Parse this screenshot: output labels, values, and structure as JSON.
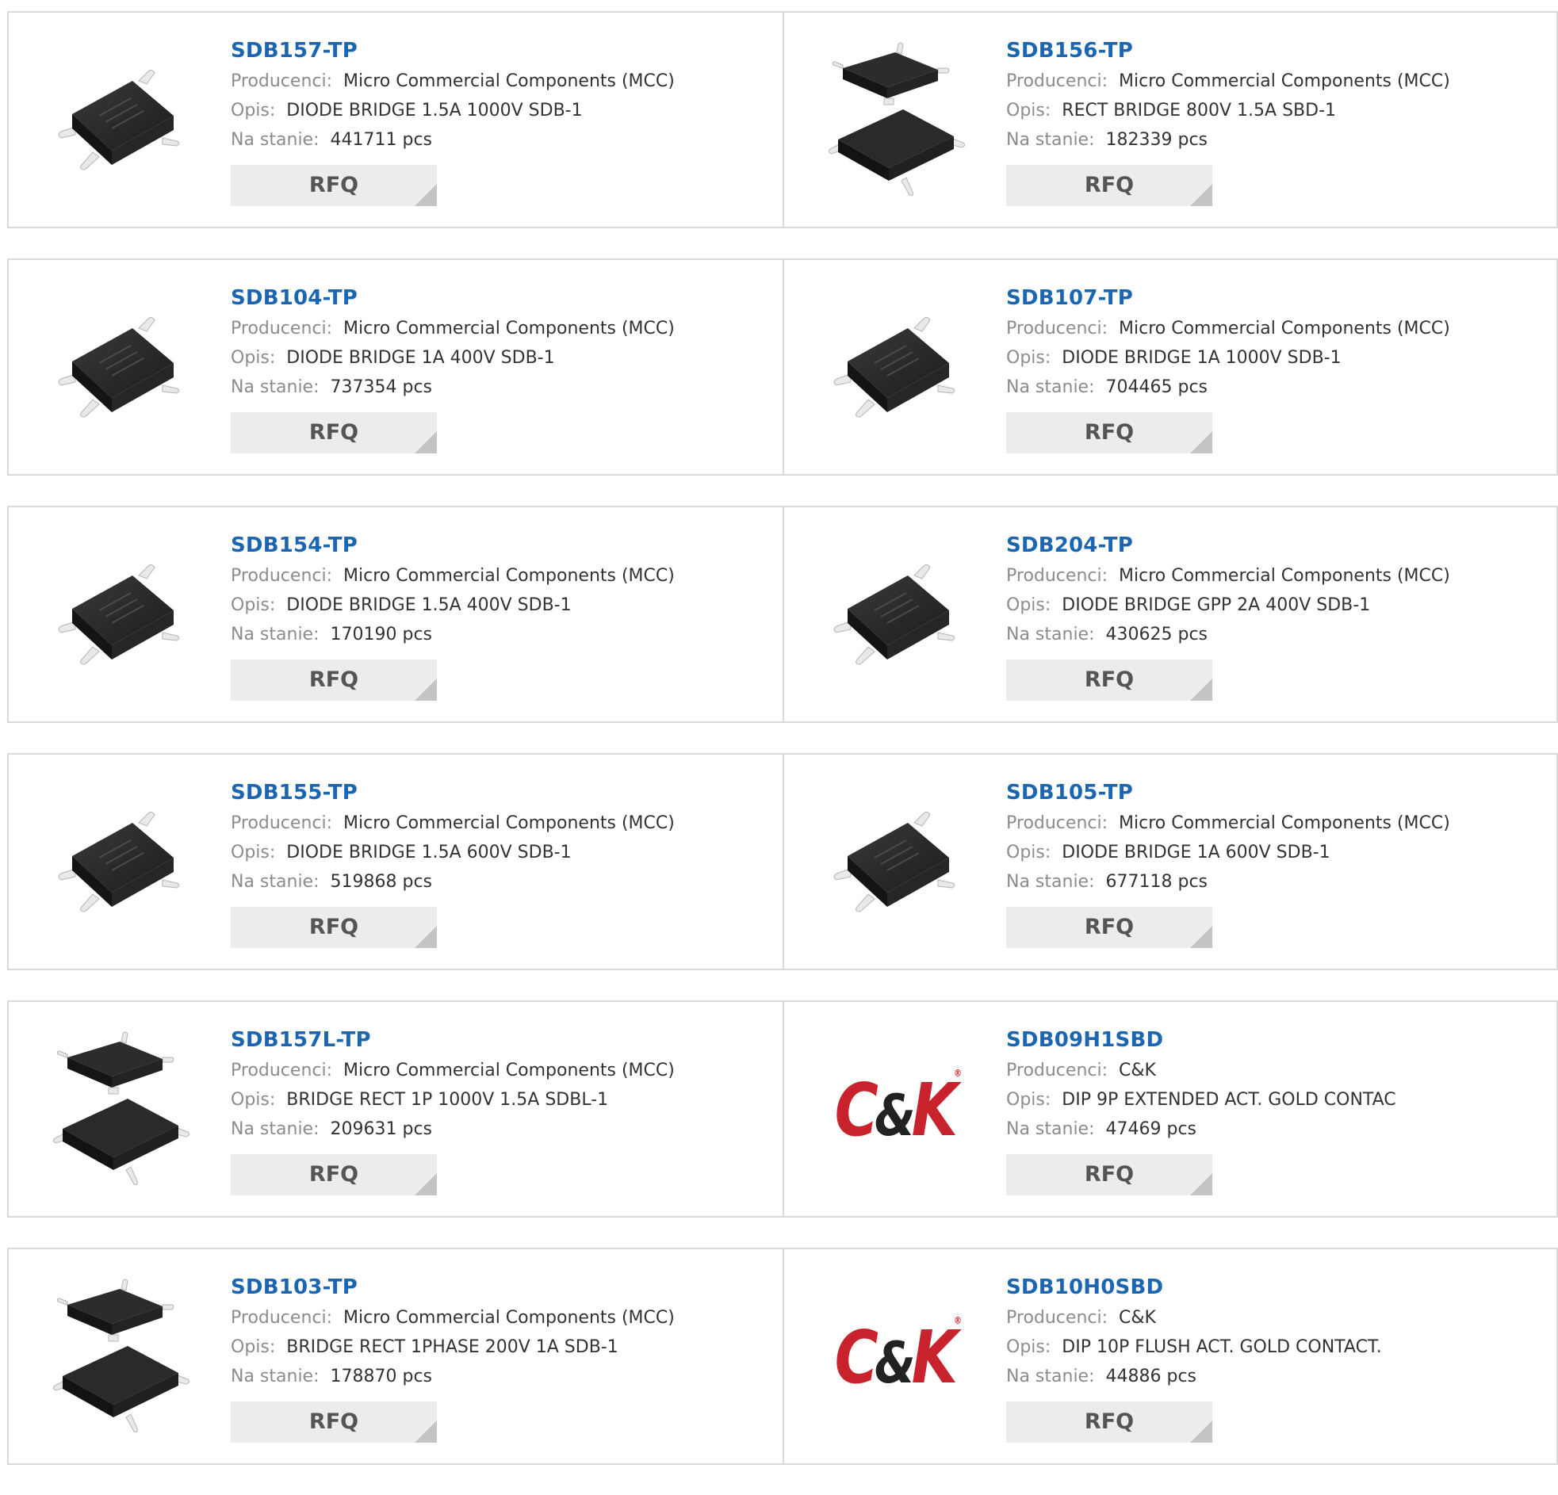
{
  "labels": {
    "manufacturer": "Producenci:",
    "description": "Opis:",
    "stock": "Na stanie:"
  },
  "rfq_label": "RFQ",
  "products": [
    {
      "part": "SDB157-TP",
      "manufacturer": "Micro Commercial Components (MCC)",
      "description": "DIODE BRIDGE 1.5A 1000V SDB-1",
      "stock": "441711 pcs",
      "image": "chip-single"
    },
    {
      "part": "SDB156-TP",
      "manufacturer": "Micro Commercial Components (MCC)",
      "description": "RECT BRIDGE 800V 1.5A SBD-1",
      "stock": "182339 pcs",
      "image": "chip-pair"
    },
    {
      "part": "SDB104-TP",
      "manufacturer": "Micro Commercial Components (MCC)",
      "description": "DIODE BRIDGE 1A 400V SDB-1",
      "stock": "737354 pcs",
      "image": "chip-single"
    },
    {
      "part": "SDB107-TP",
      "manufacturer": "Micro Commercial Components (MCC)",
      "description": "DIODE BRIDGE 1A 1000V SDB-1",
      "stock": "704465 pcs",
      "image": "chip-single"
    },
    {
      "part": "SDB154-TP",
      "manufacturer": "Micro Commercial Components (MCC)",
      "description": "DIODE BRIDGE 1.5A 400V SDB-1",
      "stock": "170190 pcs",
      "image": "chip-single"
    },
    {
      "part": "SDB204-TP",
      "manufacturer": "Micro Commercial Components (MCC)",
      "description": "DIODE BRIDGE GPP 2A 400V SDB-1",
      "stock": "430625 pcs",
      "image": "chip-single"
    },
    {
      "part": "SDB155-TP",
      "manufacturer": "Micro Commercial Components (MCC)",
      "description": "DIODE BRIDGE 1.5A 600V SDB-1",
      "stock": "519868 pcs",
      "image": "chip-single"
    },
    {
      "part": "SDB105-TP",
      "manufacturer": "Micro Commercial Components (MCC)",
      "description": "DIODE BRIDGE 1A 600V SDB-1",
      "stock": "677118 pcs",
      "image": "chip-single"
    },
    {
      "part": "SDB157L-TP",
      "manufacturer": "Micro Commercial Components (MCC)",
      "description": "BRIDGE RECT 1P 1000V 1.5A SDBL-1",
      "stock": "209631 pcs",
      "image": "chip-pair"
    },
    {
      "part": "SDB09H1SBD",
      "manufacturer": "C&K",
      "description": "DIP 9P EXTENDED ACT. GOLD CONTAC",
      "stock": "47469 pcs",
      "image": "ck-logo"
    },
    {
      "part": "SDB103-TP",
      "manufacturer": "Micro Commercial Components (MCC)",
      "description": "BRIDGE RECT 1PHASE 200V 1A SDB-1",
      "stock": "178870 pcs",
      "image": "chip-pair"
    },
    {
      "part": "SDB10H0SBD",
      "manufacturer": "C&K",
      "description": "DIP 10P FLUSH ACT. GOLD CONTACT.",
      "stock": "44886 pcs",
      "image": "ck-logo"
    }
  ],
  "ck_logo": {
    "c": "C",
    "amp": "&",
    "k": "K",
    "reg": "®"
  },
  "colors": {
    "part_link": "#1a66b3",
    "label_gray": "#8c8c8c",
    "border": "#d9d9d9",
    "button_bg": "#ececec",
    "brand_red": "#c8232c"
  }
}
